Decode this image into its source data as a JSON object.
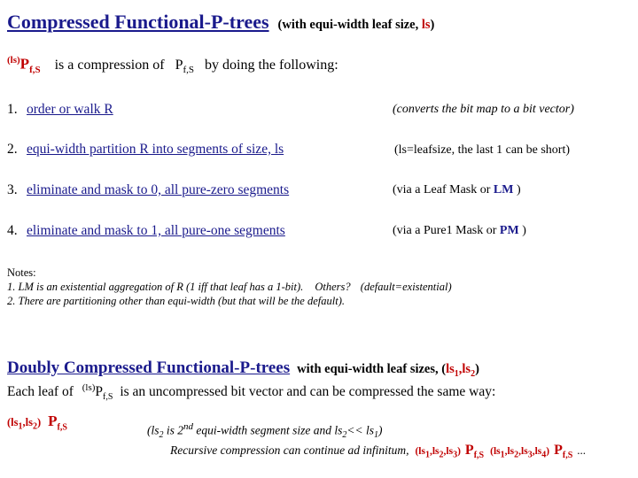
{
  "title": {
    "main": "Compressed Functional-P-trees",
    "rest_pre": "(with equi-width leaf size, ",
    "rest_ls": "ls",
    "rest_post": ")"
  },
  "definition": {
    "symbol_sup": "(ls)",
    "symbol_base": "P",
    "symbol_sub": "f,S",
    "text": "is a compression of",
    "target_base": "P",
    "target_sub": "f,S",
    "text_after": "by  doing the following:"
  },
  "steps": [
    {
      "num": "1.",
      "body": "order or walk R",
      "note": "(converts the bit map to a bit vector)",
      "note_style": "italic"
    },
    {
      "num": "2.",
      "body": "equi-width partition R into segments of size, ls",
      "note": "(ls=leafsize, the last 1 can be short)",
      "note_style": "plain"
    },
    {
      "num": "3.",
      "body": "eliminate and mask to 0, all pure-zero segments",
      "note_pre": "(via a Leaf  Mask or ",
      "note_acr": "LM",
      "note_post": " )",
      "note_style": "acronym"
    },
    {
      "num": "4.",
      "body": "eliminate and mask to 1, all pure-one  segments",
      "note_pre": "(via a Pure1 Mask or ",
      "note_acr": "PM",
      "note_post": " )",
      "note_style": "acronym"
    }
  ],
  "notes": {
    "header": "Notes:",
    "line1_a": "1.  LM is an existential aggregation of R (1 iff that leaf has a 1-bit).",
    "line1_b": "Others?",
    "line1_c": "(default=existential)",
    "line2": "2.  There are partitioning other than equi-width (but that will be the default)."
  },
  "section2": {
    "title_main": "Doubly Compressed Functional-P-trees",
    "title_rest_pre": "with equi-width leaf sizes, (",
    "title_rest_ls1": "ls",
    "title_rest_ls1sub": "1",
    "title_rest_comma": ",",
    "title_rest_ls2": "ls",
    "title_rest_ls2sub": "2",
    "title_rest_post": ")",
    "line2_a": "Each leaf of",
    "line2_sup": "(ls)",
    "line2_base": "P",
    "line2_sub": "f,S",
    "line2_b": "is an uncompressed bit vector and can be compressed the same way:",
    "left_pre_open": "(",
    "left_pre": "ls",
    "left_pre_sub1": "1",
    "left_pre_comma": ",",
    "left_pre2": "ls",
    "left_pre_sub2": "2",
    "left_pre_close": ")",
    "left_p": "P",
    "left_p_sub": "f,S",
    "note1": "(ls",
    "note1_sub": "2",
    "note1_b": " is 2",
    "note1_sup": "nd",
    "note1_c": " equi-width segment size and ls",
    "note1_sub2": "2",
    "note1_d": "<< ls",
    "note1_sub3": "1",
    "note1_e": ")",
    "note2": "Recursive compression can continue ad infinitum,",
    "note2_pre1_open": "(",
    "note2_pre1": "ls",
    "note2_pre1_s1": "1",
    "note2_pre1_c1": ",ls",
    "note2_pre1_s2": "2",
    "note2_pre1_c2": ",ls",
    "note2_pre1_s3": "3",
    "note2_pre1_close": ")",
    "note2_p1": "P",
    "note2_p1_sub": "f,S",
    "note2_pre2_open": "(",
    "note2_pre2": "ls",
    "note2_pre2_s1": "1",
    "note2_pre2_c1": ",ls",
    "note2_pre2_s2": "2",
    "note2_pre2_c2": ",ls",
    "note2_pre2_s3": "3",
    "note2_pre2_c3": ",ls",
    "note2_pre2_s4": "4",
    "note2_pre2_close": ")",
    "note2_p2": "P",
    "note2_p2_sub": "f,S",
    "note2_dots": "..."
  },
  "colors": {
    "heading_blue": "#1a1a8c",
    "accent_red": "#c00000"
  }
}
